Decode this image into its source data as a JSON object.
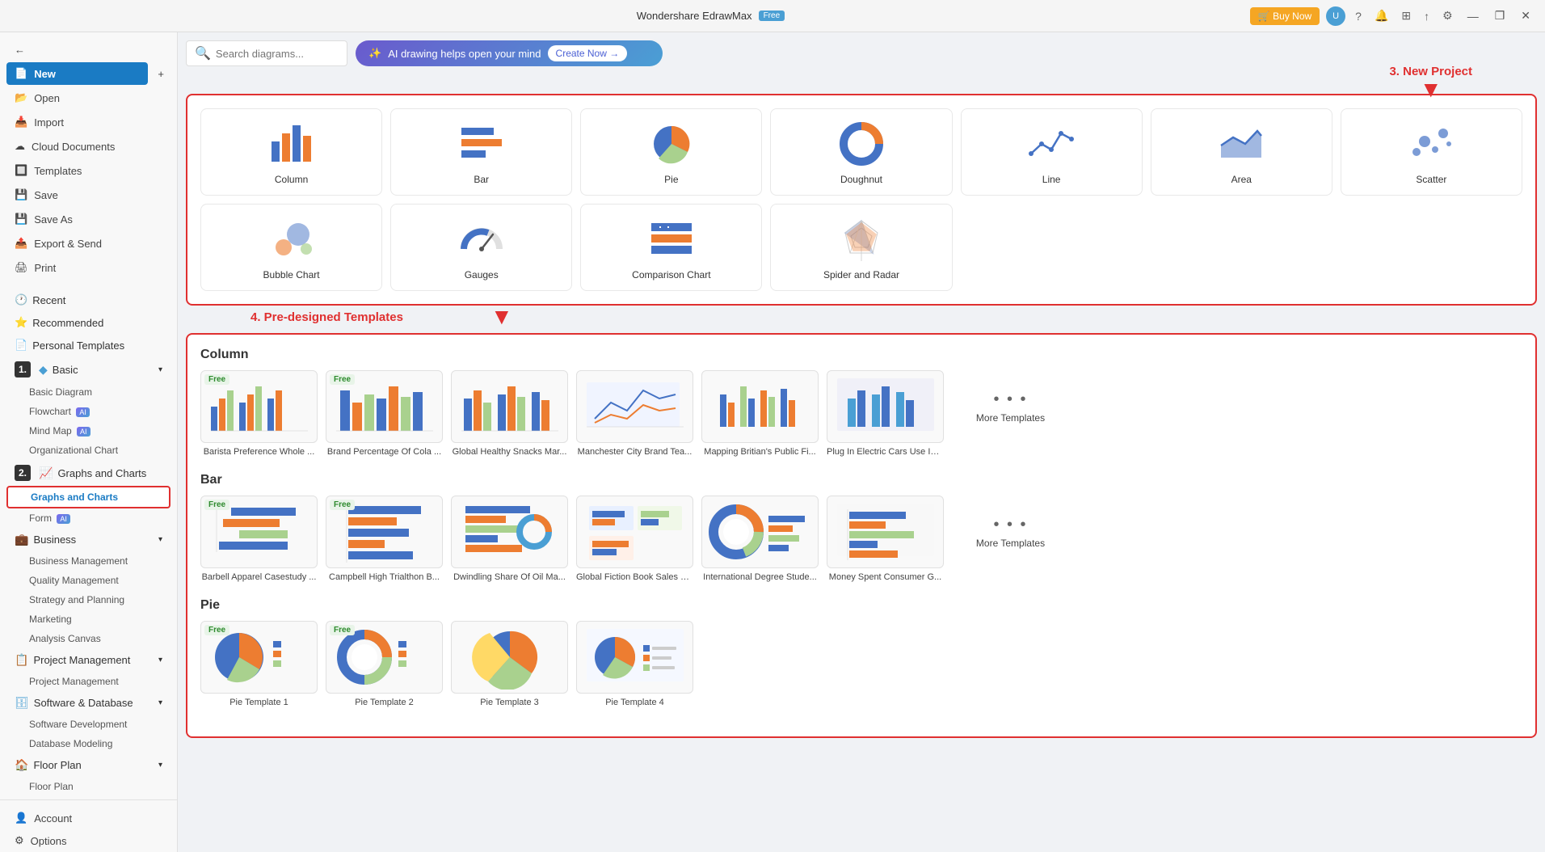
{
  "titlebar": {
    "app_name": "Wondershare EdrawMax",
    "badge": "Free",
    "buy_now": "🛒 Buy Now",
    "win_min": "—",
    "win_max": "❐",
    "win_close": "✕"
  },
  "sidebar": {
    "back_icon": "←",
    "new_label": "New",
    "plus_icon": "+",
    "open_label": "Open",
    "import_label": "Import",
    "cloud_label": "Cloud Documents",
    "templates_label": "Templates",
    "save_label": "Save",
    "save_as_label": "Save As",
    "export_label": "Export & Send",
    "print_label": "Print",
    "step1": "1.",
    "step2": "2.",
    "sections": [
      {
        "label": "Recent",
        "icon": "🕐",
        "children": []
      },
      {
        "label": "Recommended",
        "icon": "⭐",
        "children": []
      },
      {
        "label": "Personal Templates",
        "icon": "📄",
        "children": []
      },
      {
        "label": "Basic",
        "icon": "📊",
        "has_arrow": true,
        "children": [
          {
            "label": "Basic Diagram",
            "ai": false
          },
          {
            "label": "Flowchart",
            "ai": true
          },
          {
            "label": "Mind Map",
            "ai": true
          },
          {
            "label": "Organizational Chart",
            "ai": false
          }
        ]
      },
      {
        "label": "Graphs and Charts",
        "icon": "📈",
        "active": true,
        "children": [
          {
            "label": "Form",
            "ai": true
          }
        ]
      },
      {
        "label": "Business",
        "icon": "💼",
        "has_arrow": true,
        "children": [
          {
            "label": "Business Management"
          },
          {
            "label": "Quality Management"
          },
          {
            "label": "Strategy and Planning"
          },
          {
            "label": "Marketing"
          },
          {
            "label": "Analysis Canvas"
          }
        ]
      },
      {
        "label": "Project Management",
        "icon": "📋",
        "has_arrow": true,
        "children": [
          {
            "label": "Project Management"
          }
        ]
      },
      {
        "label": "Software & Database",
        "icon": "🗄",
        "has_arrow": true,
        "children": [
          {
            "label": "Software Development"
          },
          {
            "label": "Database Modeling"
          }
        ]
      },
      {
        "label": "Floor Plan",
        "icon": "🏠",
        "has_arrow": true,
        "children": [
          {
            "label": "Floor Plan"
          }
        ]
      }
    ],
    "bottom": [
      {
        "label": "Account",
        "icon": "👤"
      },
      {
        "label": "Options",
        "icon": "⚙"
      }
    ]
  },
  "search": {
    "placeholder": "Search diagrams...",
    "ai_banner": "AI drawing helps open your mind",
    "create_now": "Create Now →"
  },
  "new_project": {
    "label": "3. New Project",
    "chart_types": [
      {
        "label": "Column",
        "icon": "column"
      },
      {
        "label": "Bar",
        "icon": "bar"
      },
      {
        "label": "Pie",
        "icon": "pie"
      },
      {
        "label": "Doughnut",
        "icon": "doughnut"
      },
      {
        "label": "Line",
        "icon": "line"
      },
      {
        "label": "Area",
        "icon": "area"
      },
      {
        "label": "Scatter",
        "icon": "scatter"
      },
      {
        "label": "Bubble Chart",
        "icon": "bubble"
      },
      {
        "label": "Gauges",
        "icon": "gauges"
      },
      {
        "label": "Comparison Chart",
        "icon": "comparison"
      },
      {
        "label": "Spider and Radar",
        "icon": "spider"
      }
    ]
  },
  "templates": {
    "label": "4. Pre-designed Templates",
    "categories": [
      {
        "title": "Column",
        "items": [
          {
            "name": "Barista Preference Whole ...",
            "free": true
          },
          {
            "name": "Brand Percentage Of Cola ...",
            "free": true
          },
          {
            "name": "Global Healthy Snacks Mar...",
            "free": false
          },
          {
            "name": "Manchester City Brand Tea...",
            "free": false
          },
          {
            "name": "Mapping Britian's Public Fi...",
            "free": false
          },
          {
            "name": "Plug In Electric Cars Use In ...",
            "free": false
          }
        ],
        "more": "More Templates"
      },
      {
        "title": "Bar",
        "items": [
          {
            "name": "Barbell Apparel Casestudy ...",
            "free": true
          },
          {
            "name": "Campbell High Trialthon B...",
            "free": true
          },
          {
            "name": "Dwindling Share Of Oil Ma...",
            "free": false
          },
          {
            "name": "Global Fiction Book Sales B...",
            "free": false
          },
          {
            "name": "International Degree Stude...",
            "free": false
          },
          {
            "name": "Money Spent Consumer G...",
            "free": false
          }
        ],
        "more": "More Templates"
      },
      {
        "title": "Pie",
        "items": [
          {
            "name": "Pie Template 1",
            "free": true
          },
          {
            "name": "Pie Template 2",
            "free": true
          },
          {
            "name": "Pie Template 3",
            "free": false
          },
          {
            "name": "Pie Template 4",
            "free": false
          }
        ],
        "more": ""
      }
    ]
  }
}
